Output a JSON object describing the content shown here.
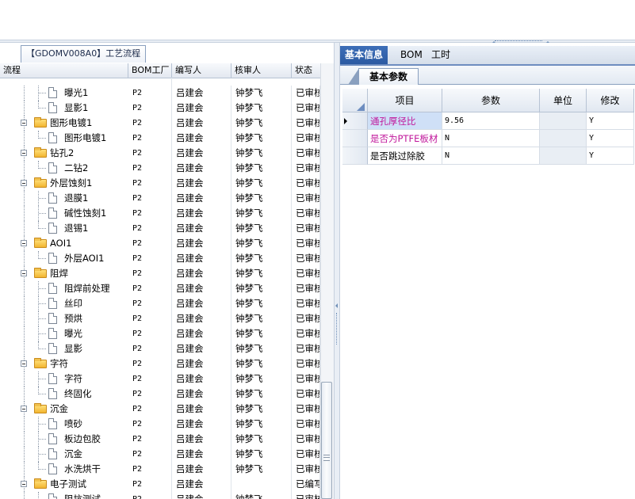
{
  "left_panel": {
    "tab_title": "【GDOMV008A0】工艺流程",
    "columns": [
      "流程",
      "BOM工厂",
      "编写人",
      "核审人",
      "状态"
    ],
    "rows": [
      {
        "label": "曝光1",
        "kind": "doc",
        "level": 2,
        "bom": "P2",
        "writer": "吕建会",
        "reviewer": "钟梦飞",
        "status": "已审核",
        "partial": false
      },
      {
        "label": "显影1",
        "kind": "doc",
        "level": 2,
        "bom": "P2",
        "writer": "吕建会",
        "reviewer": "钟梦飞",
        "status": "已审核"
      },
      {
        "label": "图形电镀1",
        "kind": "folder",
        "level": 1,
        "bom": "P2",
        "writer": "吕建会",
        "reviewer": "钟梦飞",
        "status": "已审核"
      },
      {
        "label": "图形电镀1",
        "kind": "doc",
        "level": 2,
        "bom": "P2",
        "writer": "吕建会",
        "reviewer": "钟梦飞",
        "status": "已审核"
      },
      {
        "label": "钻孔2",
        "kind": "folder",
        "level": 1,
        "bom": "P2",
        "writer": "吕建会",
        "reviewer": "钟梦飞",
        "status": "已审核"
      },
      {
        "label": "二钻2",
        "kind": "doc",
        "level": 2,
        "bom": "P2",
        "writer": "吕建会",
        "reviewer": "钟梦飞",
        "status": "已审核"
      },
      {
        "label": "外层蚀刻1",
        "kind": "folder",
        "level": 1,
        "bom": "P2",
        "writer": "吕建会",
        "reviewer": "钟梦飞",
        "status": "已审核"
      },
      {
        "label": "退膜1",
        "kind": "doc",
        "level": 2,
        "bom": "P2",
        "writer": "吕建会",
        "reviewer": "钟梦飞",
        "status": "已审核"
      },
      {
        "label": "碱性蚀刻1",
        "kind": "doc",
        "level": 2,
        "bom": "P2",
        "writer": "吕建会",
        "reviewer": "钟梦飞",
        "status": "已审核"
      },
      {
        "label": "退锡1",
        "kind": "doc",
        "level": 2,
        "bom": "P2",
        "writer": "吕建会",
        "reviewer": "钟梦飞",
        "status": "已审核"
      },
      {
        "label": "AOI1",
        "kind": "folder",
        "level": 1,
        "bom": "P2",
        "writer": "吕建会",
        "reviewer": "钟梦飞",
        "status": "已审核"
      },
      {
        "label": "外层AOI1",
        "kind": "doc",
        "level": 2,
        "bom": "P2",
        "writer": "吕建会",
        "reviewer": "钟梦飞",
        "status": "已审核"
      },
      {
        "label": "阻焊",
        "kind": "folder",
        "level": 1,
        "bom": "P2",
        "writer": "吕建会",
        "reviewer": "钟梦飞",
        "status": "已审核"
      },
      {
        "label": "阻焊前处理",
        "kind": "doc",
        "level": 2,
        "bom": "P2",
        "writer": "吕建会",
        "reviewer": "钟梦飞",
        "status": "已审核"
      },
      {
        "label": "丝印",
        "kind": "doc",
        "level": 2,
        "bom": "P2",
        "writer": "吕建会",
        "reviewer": "钟梦飞",
        "status": "已审核"
      },
      {
        "label": "预烘",
        "kind": "doc",
        "level": 2,
        "bom": "P2",
        "writer": "吕建会",
        "reviewer": "钟梦飞",
        "status": "已审核"
      },
      {
        "label": "曝光",
        "kind": "doc",
        "level": 2,
        "bom": "P2",
        "writer": "吕建会",
        "reviewer": "钟梦飞",
        "status": "已审核"
      },
      {
        "label": "显影",
        "kind": "doc",
        "level": 2,
        "bom": "P2",
        "writer": "吕建会",
        "reviewer": "钟梦飞",
        "status": "已审核"
      },
      {
        "label": "字符",
        "kind": "folder",
        "level": 1,
        "bom": "P2",
        "writer": "吕建会",
        "reviewer": "钟梦飞",
        "status": "已审核"
      },
      {
        "label": "字符",
        "kind": "doc",
        "level": 2,
        "bom": "P2",
        "writer": "吕建会",
        "reviewer": "钟梦飞",
        "status": "已审核"
      },
      {
        "label": "终固化",
        "kind": "doc",
        "level": 2,
        "bom": "P2",
        "writer": "吕建会",
        "reviewer": "钟梦飞",
        "status": "已审核"
      },
      {
        "label": "沉金",
        "kind": "folder",
        "level": 1,
        "bom": "P2",
        "writer": "吕建会",
        "reviewer": "钟梦飞",
        "status": "已审核"
      },
      {
        "label": "喷砂",
        "kind": "doc",
        "level": 2,
        "bom": "P2",
        "writer": "吕建会",
        "reviewer": "钟梦飞",
        "status": "已审核"
      },
      {
        "label": "板边包胶",
        "kind": "doc",
        "level": 2,
        "bom": "P2",
        "writer": "吕建会",
        "reviewer": "钟梦飞",
        "status": "已审核"
      },
      {
        "label": "沉金",
        "kind": "doc",
        "level": 2,
        "bom": "P2",
        "writer": "吕建会",
        "reviewer": "钟梦飞",
        "status": "已审核"
      },
      {
        "label": "水洗烘干",
        "kind": "doc",
        "level": 2,
        "bom": "P2",
        "writer": "吕建会",
        "reviewer": "钟梦飞",
        "status": "已审核"
      },
      {
        "label": "电子测试",
        "kind": "folder",
        "level": 1,
        "bom": "P2",
        "writer": "吕建会",
        "reviewer": "",
        "status": "已编写"
      },
      {
        "label": "阻抗测试",
        "kind": "doc",
        "level": 2,
        "bom": "P2",
        "writer": "吕建会",
        "reviewer": "钟梦飞",
        "status": "已审核"
      }
    ]
  },
  "right_panel": {
    "tabs": [
      "基本信息",
      "BOM",
      "工时"
    ],
    "active_tab": 0,
    "subtab": "基本参数",
    "columns": [
      "项目",
      "参数",
      "单位",
      "修改"
    ],
    "rows": [
      {
        "item": "通孔厚径比",
        "value": "9.56",
        "unit": "",
        "editable": "Y",
        "highlight": true,
        "selected": true
      },
      {
        "item": "是否为PTFE板材",
        "value": "N",
        "unit": "",
        "editable": "Y",
        "highlight": true,
        "selected": false
      },
      {
        "item": "是否跳过除胶",
        "value": "N",
        "unit": "",
        "editable": "Y",
        "highlight": false,
        "selected": false
      }
    ]
  },
  "colors": {
    "accent": "#2b5aa2",
    "highlight_text": "#c0169b",
    "selected_row_bg": "#cfe0f7"
  }
}
